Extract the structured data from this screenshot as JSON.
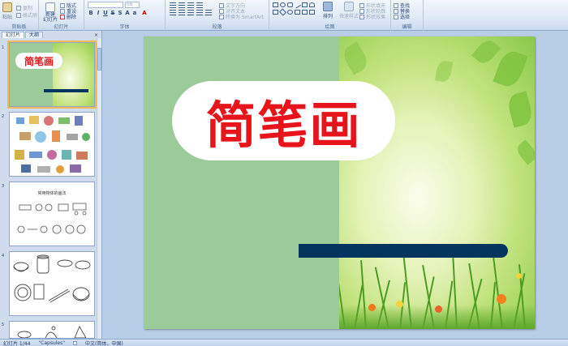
{
  "ribbon": {
    "groups": [
      {
        "label": "剪贴板"
      },
      {
        "label": "幻灯片"
      },
      {
        "label": "字体"
      },
      {
        "label": "段落"
      },
      {
        "label": "绘图"
      },
      {
        "label": "编辑"
      }
    ],
    "clipboard": {
      "paste": "粘贴",
      "copy": "复制",
      "format_painter": "格式刷"
    },
    "slides": {
      "new_slide": "新建\n幻灯片",
      "layout": "版式",
      "reset": "重设",
      "delete": "删除"
    },
    "font": {
      "size_value": "66"
    },
    "paragraph": {
      "text_direction": "文字方向",
      "align_text": "对齐文本",
      "convert_smartart": "转换为 SmartArt"
    },
    "drawing": {
      "arrange": "排列",
      "quick_styles": "快速样式",
      "shape_fill": "形状填充",
      "shape_outline": "形状轮廓",
      "shape_effects": "形状效果"
    },
    "editing": {
      "find": "查找",
      "replace": "替换",
      "select": "选择"
    }
  },
  "left_pane": {
    "tabs": [
      {
        "label": "幻灯片",
        "active": true
      },
      {
        "label": "大纲",
        "active": false
      }
    ],
    "close": "×",
    "thumbnails": [
      {
        "number": "1",
        "title": "简笔画"
      },
      {
        "number": "2"
      },
      {
        "number": "3",
        "caption": "常用物体的画法"
      },
      {
        "number": "4"
      },
      {
        "number": "5"
      }
    ]
  },
  "slide": {
    "title": "简笔画"
  },
  "status_bar": {
    "slide_counter": "幻灯片 1/44",
    "theme": "\"Capsules\"",
    "language": "中文(简体，中国)"
  },
  "colors": {
    "title_red": "#e8141c",
    "navy_bar": "#04355f",
    "slide_green": "#9ccb9a",
    "selected_outline": "#f2b65c"
  }
}
